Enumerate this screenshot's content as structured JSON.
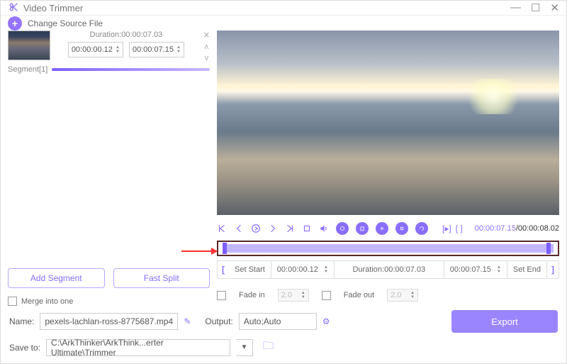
{
  "window": {
    "title": "Video Trimmer"
  },
  "toolbar": {
    "change_source": "Change Source File"
  },
  "segment": {
    "duration_label": "Duration:00:00:07.03",
    "start_time": "00:00:00.12",
    "end_time": "00:00:07.15",
    "label": "Segment[1]"
  },
  "buttons": {
    "add_segment": "Add Segment",
    "fast_split": "Fast Split",
    "merge": "Merge into one",
    "export": "Export"
  },
  "playback": {
    "current": "00:00:07.15",
    "total": "/00:00:08.02"
  },
  "trim": {
    "set_start": "Set Start",
    "start_time": "00:00:00.12",
    "duration": "Duration:00:00:07.03",
    "end_time": "00:00:07.15",
    "set_end": "Set End"
  },
  "fade": {
    "in_label": "Fade in",
    "in_value": "2.0",
    "out_label": "Fade out",
    "out_value": "2.0"
  },
  "output_row": {
    "name_label": "Name:",
    "name_value": "pexels-lachlan-ross-8775687.mp4",
    "output_label": "Output:",
    "output_value": "Auto;Auto"
  },
  "save_row": {
    "label": "Save to:",
    "path": "C:\\ArkThinker\\ArkThink...erter Ultimate\\Trimmer"
  }
}
